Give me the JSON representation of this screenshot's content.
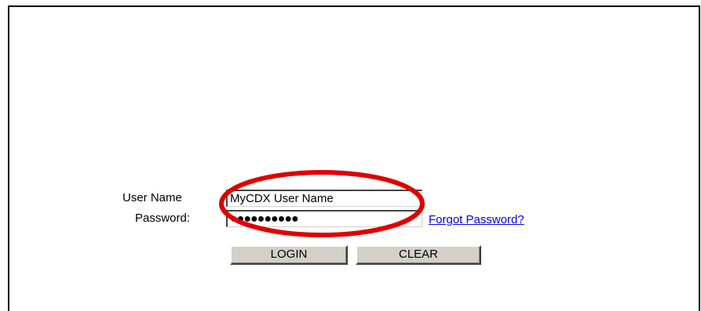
{
  "login_form": {
    "username_label": "User Name",
    "username_value": "MyCDX User Name",
    "password_label": "Password:",
    "password_value": "●●●●●●●●●●",
    "forgot_password_link": "Forgot Password?",
    "login_button": "LOGIN",
    "clear_button": "CLEAR"
  },
  "annotation": {
    "highlight_color": "#e00000"
  }
}
